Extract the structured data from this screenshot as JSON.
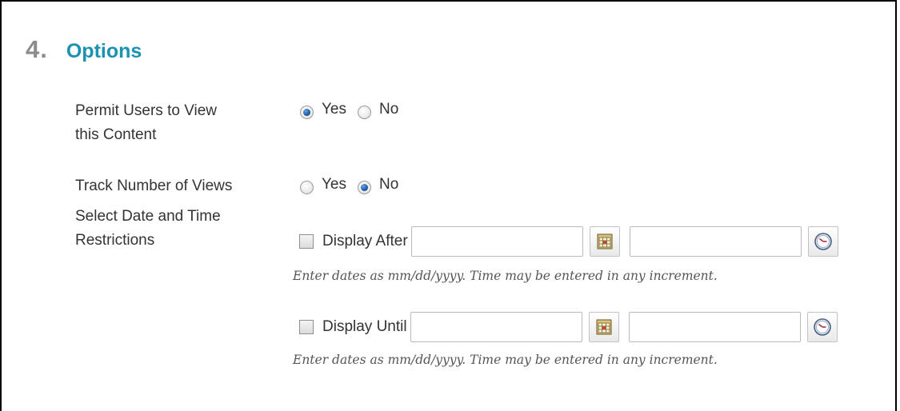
{
  "section": {
    "number": "4.",
    "title": "Options"
  },
  "permit_view": {
    "label_line1": "Permit Users to View",
    "label_line2": "this Content",
    "options": [
      {
        "label": "Yes",
        "checked": true
      },
      {
        "label": "No",
        "checked": false
      }
    ]
  },
  "track_views": {
    "label": "Track Number of Views",
    "options": [
      {
        "label": "Yes",
        "checked": false
      },
      {
        "label": "No",
        "checked": true
      }
    ]
  },
  "date_restrictions": {
    "label_line1": "Select Date and Time",
    "label_line2": "Restrictions",
    "after": {
      "label": "Display After",
      "date_value": "",
      "time_value": "",
      "hint": "Enter dates as mm/dd/yyyy. Time may be entered in any increment."
    },
    "until": {
      "label": "Display Until",
      "date_value": "",
      "time_value": "",
      "hint": "Enter dates as mm/dd/yyyy. Time may be entered in any increment."
    }
  },
  "icons": {
    "calendar": "calendar-icon",
    "clock": "clock-icon"
  },
  "colors": {
    "title": "#1c92b3",
    "step_number": "#8c8c8c",
    "radio_checked": "#1d5aa6"
  }
}
